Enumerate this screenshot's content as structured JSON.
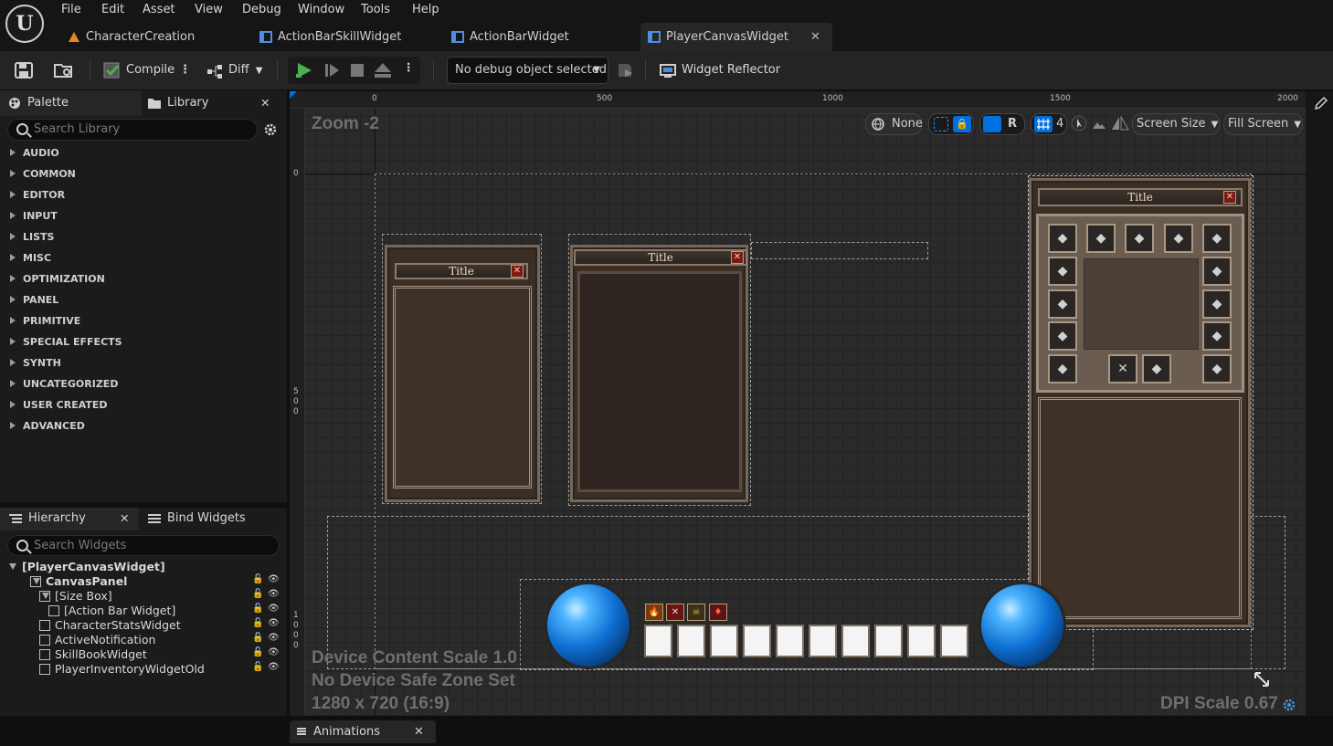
{
  "app": {
    "logo": "U"
  },
  "menu": [
    "File",
    "Edit",
    "Asset",
    "View",
    "Debug",
    "Window",
    "Tools",
    "Help"
  ],
  "tabs": [
    {
      "label": "CharacterCreation",
      "icon": "level-icon"
    },
    {
      "label": "ActionBarSkillWidget",
      "icon": "widget-blueprint-icon"
    },
    {
      "label": "ActionBarWidget",
      "icon": "widget-blueprint-icon"
    },
    {
      "label": "PlayerCanvasWidget",
      "icon": "widget-blueprint-icon",
      "active": true
    }
  ],
  "toolbar": {
    "compile": "Compile",
    "diff": "Diff",
    "debug_object": "No debug object selected",
    "widget_reflector": "Widget Reflector"
  },
  "palette": {
    "tab": "Palette",
    "library_tab": "Library",
    "search_placeholder": "Search Library",
    "categories": [
      "AUDIO",
      "COMMON",
      "EDITOR",
      "INPUT",
      "LISTS",
      "MISC",
      "OPTIMIZATION",
      "PANEL",
      "PRIMITIVE",
      "SPECIAL EFFECTS",
      "SYNTH",
      "UNCATEGORIZED",
      "USER CREATED",
      "ADVANCED"
    ]
  },
  "hierarchy": {
    "tab": "Hierarchy",
    "bind_tab": "Bind Widgets",
    "search_placeholder": "Search Widgets",
    "items": [
      "[PlayerCanvasWidget]",
      "CanvasPanel",
      "[Size Box]",
      "[Action Bar Widget]",
      "CharacterStatsWidget",
      "ActiveNotification",
      "SkillBookWidget",
      "PlayerInventoryWidgetOld"
    ]
  },
  "viewport": {
    "zoom": "Zoom -2",
    "ruler_top": [
      "0",
      "500",
      "1000",
      "1500",
      "2000"
    ],
    "ruler_left_0": "0",
    "ruler_left_500": [
      "5",
      "0",
      "0"
    ],
    "ruler_left_1000": [
      "1",
      "0",
      "0",
      "0"
    ],
    "chips": {
      "localization": "None",
      "r": "R",
      "grid": "4",
      "screen_size": "Screen Size",
      "fill_screen": "Fill Screen"
    },
    "device_scale": "Device Content Scale 1.0",
    "safe_zone": "No Device Safe Zone Set",
    "resolution": "1280 x 720 (16:9)",
    "dpi": "DPI Scale 0.67",
    "window_titles": [
      "Title",
      "Title",
      "Title"
    ]
  },
  "bottom": {
    "animations": "Animations"
  },
  "colors": {
    "accent": "#0070e0",
    "play": "#4caf50"
  }
}
